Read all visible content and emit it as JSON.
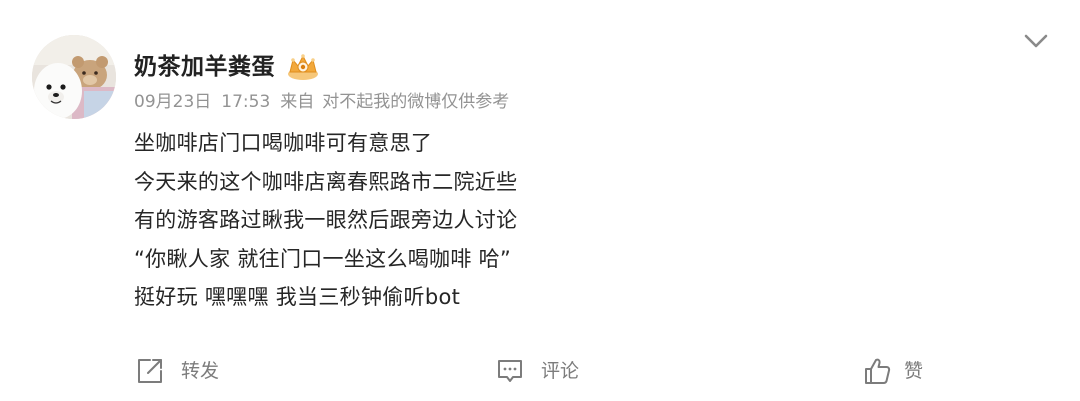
{
  "post": {
    "author": {
      "name": "奶茶加羊粪蛋",
      "badge_icon": "vip-crown-icon"
    },
    "meta": {
      "date": "09月23日",
      "time": "17:53",
      "from_label": "来自",
      "source": "对不起我的微博仅供参考"
    },
    "content_lines": [
      "坐咖啡店门口喝咖啡可有意思了",
      "今天来的这个咖啡店离春熙路市二院近些",
      "有的游客路过瞅我一眼然后跟旁边人讨论",
      "“你瞅人家 就往门口一坐这么喝咖啡 哈”",
      "挺好玩 嘿嘿嘿 我当三秒钟偷听bot"
    ],
    "actions": {
      "repost_label": "转发",
      "comment_label": "评论",
      "like_label": "赞"
    }
  },
  "colors": {
    "text_primary": "#262626",
    "text_meta": "#939393",
    "action_text": "#7c7c7c",
    "badge_gold": "#f0a93a"
  }
}
